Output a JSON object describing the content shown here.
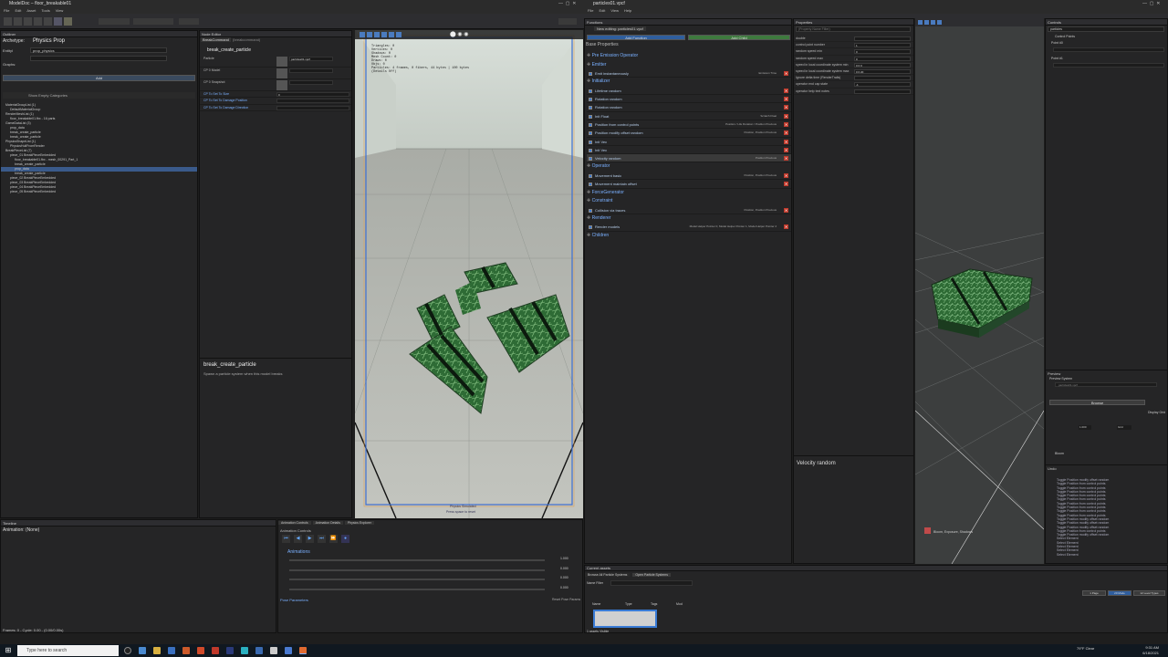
{
  "windows": {
    "left_title": "ModelDoc – floor_breakable01",
    "right_title": "particles01.vpcf"
  },
  "left_menu": [
    "File",
    "Edit",
    "Asset",
    "Tools",
    "View"
  ],
  "right_menu": [
    "File",
    "Edit",
    "View",
    "Help"
  ],
  "outliner": {
    "header": "Outliner",
    "archetype_label": "Archetype:",
    "archetype_value": "Physics Prop",
    "entity_label": "EntityI",
    "entity_value": "prop_physics",
    "graphs_label": "Graphs:",
    "add_button": "Add",
    "show_empty": "Show Empty Categories",
    "tree": [
      {
        "label": "MaterialGroupList (1)",
        "indent": 1
      },
      {
        "label": "DefaultMaterialGroup",
        "indent": 2
      },
      {
        "label": "RenderMeshList (1)",
        "indent": 1
      },
      {
        "label": "floor_breakable01.fbx - 16 parts",
        "indent": 2
      },
      {
        "label": "GameDataList (3)",
        "indent": 1
      },
      {
        "label": "prop_data",
        "indent": 2
      },
      {
        "label": "break_create_particle",
        "indent": 2
      },
      {
        "label": "break_create_particle",
        "indent": 2
      },
      {
        "label": "PhysicsShapeList (1)",
        "indent": 1
      },
      {
        "label": "PhysicsHullFromRender",
        "indent": 2
      },
      {
        "label": "BreakPieceList (7)",
        "indent": 1
      },
      {
        "label": "piece_01  BreakPieceEmbedded",
        "indent": 2
      },
      {
        "label": "floor_breakable01.fbx - mesh_00291_Part_1",
        "indent": 3
      },
      {
        "label": "break_create_particle",
        "indent": 3
      },
      {
        "label": "prop_data",
        "indent": 3
      },
      {
        "label": "break_create_particle",
        "indent": 3
      },
      {
        "label": "piece_02  BreakPieceEmbedded",
        "indent": 2
      },
      {
        "label": "piece_03  BreakPieceEmbedded",
        "indent": 2
      },
      {
        "label": "piece_04  BreakPieceEmbedded",
        "indent": 2
      },
      {
        "label": "piece_05  BreakPieceEmbedded",
        "indent": 2
      }
    ]
  },
  "node_editor": {
    "header": "Node Editor",
    "tab": "BreakCommand",
    "tab2": "(breakcommand)",
    "node_title": "break_create_particle",
    "fields": [
      {
        "label": "Particle",
        "value": "particles01.vpcf"
      },
      {
        "label": "CP 0 Model",
        "value": ""
      },
      {
        "label": "CP 0 Snapshot",
        "value": ""
      },
      {
        "label": "CP To Set To Size",
        "value": "0"
      },
      {
        "label": "CP To Set To Damage Position",
        "value": ""
      },
      {
        "label": "CP To Set To Damage Direction",
        "value": ""
      }
    ],
    "desc_title": "break_create_particle",
    "desc_text": "Spawn a particle system when this model breaks"
  },
  "viewport": {
    "stats": [
      "Triangles: 0",
      "Vertices: 0",
      "Shadows: 0",
      "Mesh Count: 0",
      "Draws: 0",
      "Objs: 0",
      "Particles: 4 frames, 0 fibers, 44 bytes | 100 bytes",
      "(Details Off)"
    ],
    "bottom_label": "Physics Simulated",
    "bottom_label2": "Press space to reset"
  },
  "animation": {
    "timeline_header": "Timeline",
    "animation_label": "Animation: (None)",
    "tabs": [
      "Animation Controls",
      "Animation Details",
      "Physics Explorer"
    ],
    "controls_label": "Animation Controls",
    "animations_label": "Animations",
    "pose_params": "Pose Parameters",
    "reset_pose": "Reset Pose Params",
    "frames_text": "Frames: 0 - Cycle: 0.00 - (0.00/0.00s)",
    "values": [
      "1.000",
      "0.000",
      "0.000",
      "0.000"
    ]
  },
  "functions": {
    "header": "Functions",
    "tab": "New editing: particles01.vpcf",
    "add_function": "Add Function",
    "add_child": "Add Child",
    "base_properties": "Base Properties",
    "items": [
      {
        "type": "section",
        "label": "Pre Emission Operator"
      },
      {
        "type": "section",
        "label": "Emitter"
      },
      {
        "type": "fn",
        "label": "Emit instantaneously",
        "right": "Emission Time"
      },
      {
        "type": "section",
        "label": "Initializer"
      },
      {
        "type": "fn",
        "label": "Lifetime random",
        "right": ""
      },
      {
        "type": "fn",
        "label": "Rotation random",
        "right": ""
      },
      {
        "type": "fn",
        "label": "Rotation random",
        "right": ""
      },
      {
        "type": "fn",
        "label": "Init Float",
        "right": "Scratch Float"
      },
      {
        "type": "fn",
        "label": "Position from control points",
        "right": "Position / Life Duration / Position Previous"
      },
      {
        "type": "fn",
        "label": "Position modify offset random",
        "right": "Position, Position Previous"
      },
      {
        "type": "fn",
        "label": "Init Vec",
        "right": ""
      },
      {
        "type": "fn",
        "label": "Init Vec",
        "right": ""
      },
      {
        "type": "fn",
        "label": "Velocity random",
        "right": "Position Previous"
      },
      {
        "type": "section",
        "label": "Operator"
      },
      {
        "type": "fn",
        "label": "Movement basic",
        "right": "Position, Position Previous"
      },
      {
        "type": "fn",
        "label": "Movement maintain offset",
        "right": ""
      },
      {
        "type": "section",
        "label": "ForceGenerator"
      },
      {
        "type": "section",
        "label": "Constraint"
      },
      {
        "type": "fn",
        "label": "Collision via traces",
        "right": "Position, Position Previous"
      },
      {
        "type": "section",
        "label": "Renderer"
      },
      {
        "type": "fn",
        "label": "Render models",
        "right": "Model Helper Pointer 0, Model Helper Pointer 1, Model Helper Pointer 2"
      },
      {
        "type": "section",
        "label": "Children"
      }
    ]
  },
  "properties": {
    "header": "Properties",
    "search_placeholder": "(Property Name Filter)",
    "rows": [
      {
        "label": "double",
        "value": ""
      },
      {
        "label": "control point number",
        "value": "1"
      },
      {
        "label": "random speed min",
        "value": "0"
      },
      {
        "label": "random speed max",
        "value": "0"
      },
      {
        "label": "speed in local coordinate system min",
        "value": "0   0   0"
      },
      {
        "label": "speed in local coordinate system max",
        "value": "0   0   20"
      },
      {
        "label": "Ignore delta time (RenderTrails)",
        "value": ""
      },
      {
        "label": "operator end cap state",
        "value": "-1"
      },
      {
        "label": "operator help text notes",
        "value": ""
      }
    ],
    "desc_title": "Velocity random"
  },
  "preview": {
    "overlay": "Bloom, Exposure, Shadows"
  },
  "controls": {
    "header": "Controls",
    "value": "particles",
    "control_points": "Control Points",
    "point0": "Point #0",
    "point1": "Point #1",
    "preview_header": "Preview",
    "preview_system": "Preview System",
    "preview_file": "particles01.vpcf",
    "browse": "Browse",
    "display_grid": "Display Grid",
    "simulation_rate": "1.000",
    "ground": "Grid",
    "bloom": "Bloom",
    "undo_header": "Undo",
    "undo_items": [
      "Toggle Position modify offset random",
      "Toggle Position from control points",
      "Toggle Position from control points",
      "Toggle Position from control points",
      "Toggle Position from control points",
      "Toggle Position from control points",
      "Toggle Position from control points",
      "Toggle Position from control points",
      "Toggle Position from control points",
      "Toggle Position from control points",
      "Toggle Position modify offset random",
      "Toggle Position modify offset random",
      "Toggle Position modify offset random",
      "Toggle Position from control points",
      "Toggle Position modify offset random",
      "Select Element",
      "Select Element",
      "Select Element",
      "Select Element",
      "Select Element"
    ]
  },
  "asset_browser": {
    "header": "Current assets",
    "tabs": [
      "Browse All Particle Systems",
      "Open Particle Systems"
    ],
    "filter": "Name Filter",
    "cols": [
      "Name",
      "Type",
      "Tags",
      "Mod"
    ],
    "status": "1 assets Visible",
    "btn1": "1 Page",
    "btn2": "20 Mode",
    "btn3": "12 Level Types"
  },
  "taskbar": {
    "search": "Type here to search",
    "temp": "79°F  Clear",
    "time": "9:31 AM",
    "date": "6/18/2021"
  }
}
